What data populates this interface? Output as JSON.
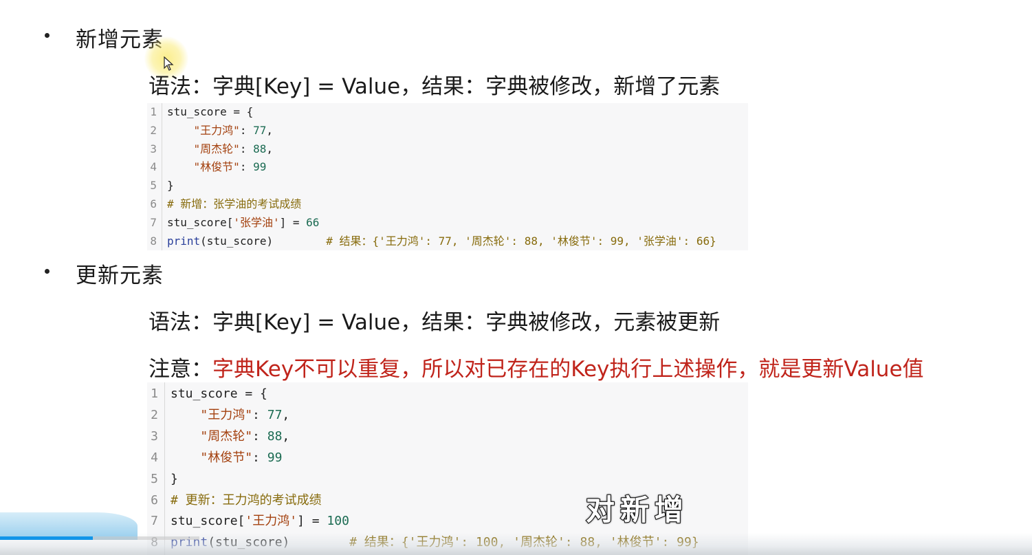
{
  "section1": {
    "heading": "新增元素",
    "syntax": "语法：字典[Key] = Value，结果：字典被修改，新增了元素",
    "code": [
      {
        "n": "1",
        "parts": [
          [
            "plain",
            "stu_score = {"
          ]
        ]
      },
      {
        "n": "2",
        "parts": [
          [
            "plain",
            "    "
          ],
          [
            "str",
            "\"王力鸿\""
          ],
          [
            "plain",
            ": "
          ],
          [
            "num",
            "77"
          ],
          [
            "plain",
            ","
          ]
        ]
      },
      {
        "n": "3",
        "parts": [
          [
            "plain",
            "    "
          ],
          [
            "str",
            "\"周杰轮\""
          ],
          [
            "plain",
            ": "
          ],
          [
            "num",
            "88"
          ],
          [
            "plain",
            ","
          ]
        ]
      },
      {
        "n": "4",
        "parts": [
          [
            "plain",
            "    "
          ],
          [
            "str",
            "\"林俊节\""
          ],
          [
            "plain",
            ": "
          ],
          [
            "num",
            "99"
          ]
        ]
      },
      {
        "n": "5",
        "parts": [
          [
            "plain",
            "}"
          ]
        ]
      },
      {
        "n": "6",
        "parts": [
          [
            "comment",
            "# 新增：张学油的考试成绩"
          ]
        ]
      },
      {
        "n": "7",
        "parts": [
          [
            "plain",
            "stu_score["
          ],
          [
            "str",
            "'张学油'"
          ],
          [
            "plain",
            "] = "
          ],
          [
            "num",
            "66"
          ]
        ]
      },
      {
        "n": "8",
        "parts": [
          [
            "fn",
            "print"
          ],
          [
            "plain",
            "(stu_score)        "
          ],
          [
            "comment",
            "# 结果：{'王力鸿': 77, '周杰轮': 88, '林俊节': 99, '张学油': 66}"
          ]
        ]
      }
    ]
  },
  "section2": {
    "heading": "更新元素",
    "syntax": "语法：字典[Key] = Value，结果：字典被修改，元素被更新",
    "note_label": "注意：",
    "note_text": "字典Key不可以重复，所以对已存在的Key执行上述操作，就是更新Value值",
    "code": [
      {
        "n": "1",
        "parts": [
          [
            "plain",
            "stu_score = {"
          ]
        ]
      },
      {
        "n": "2",
        "parts": [
          [
            "plain",
            "    "
          ],
          [
            "str",
            "\"王力鸿\""
          ],
          [
            "plain",
            ": "
          ],
          [
            "num",
            "77"
          ],
          [
            "plain",
            ","
          ]
        ]
      },
      {
        "n": "3",
        "parts": [
          [
            "plain",
            "    "
          ],
          [
            "str",
            "\"周杰轮\""
          ],
          [
            "plain",
            ": "
          ],
          [
            "num",
            "88"
          ],
          [
            "plain",
            ","
          ]
        ]
      },
      {
        "n": "4",
        "parts": [
          [
            "plain",
            "    "
          ],
          [
            "str",
            "\"林俊节\""
          ],
          [
            "plain",
            ": "
          ],
          [
            "num",
            "99"
          ]
        ]
      },
      {
        "n": "5",
        "parts": [
          [
            "plain",
            "}"
          ]
        ]
      },
      {
        "n": "6",
        "parts": [
          [
            "comment",
            "# 更新：王力鸿的考试成绩"
          ]
        ]
      },
      {
        "n": "7",
        "parts": [
          [
            "plain",
            "stu_score["
          ],
          [
            "str",
            "'王力鸿'"
          ],
          [
            "plain",
            "] = "
          ],
          [
            "num",
            "100"
          ]
        ]
      },
      {
        "n": "8",
        "parts": [
          [
            "fn",
            "print"
          ],
          [
            "plain",
            "(stu_score)        "
          ],
          [
            "comment",
            "# 结果：{'王力鸿': 100, '周杰轮': 88, '林俊节': 99}"
          ]
        ]
      }
    ]
  },
  "subtitle": "对新增",
  "video": {
    "progress": 0.09
  },
  "colors": {
    "note_red": "#c0241b",
    "progress": "#1295e8",
    "string": "#a3400e",
    "number": "#1b6b52",
    "comment": "#876b0c",
    "function": "#2a3f9a"
  }
}
